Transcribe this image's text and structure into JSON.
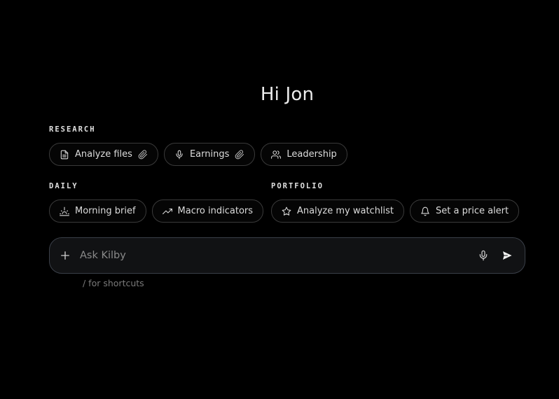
{
  "greeting": "Hi Jon",
  "sections": {
    "research": {
      "label": "RESEARCH",
      "chips": [
        {
          "label": "Analyze files",
          "icon": "file-icon",
          "trailing_icon": "paperclip-icon"
        },
        {
          "label": "Earnings",
          "icon": "microphone-icon",
          "trailing_icon": "paperclip-icon"
        },
        {
          "label": "Leadership",
          "icon": "users-icon"
        }
      ]
    },
    "daily": {
      "label": "DAILY",
      "chips": [
        {
          "label": "Morning brief",
          "icon": "sunrise-icon"
        },
        {
          "label": "Macro indicators",
          "icon": "trending-up-icon"
        }
      ]
    },
    "portfolio": {
      "label": "PORTFOLIO",
      "chips": [
        {
          "label": "Analyze my watchlist",
          "icon": "star-icon"
        },
        {
          "label": "Set a price alert",
          "icon": "bell-icon"
        }
      ]
    }
  },
  "composer": {
    "placeholder": "Ask Kilby",
    "value": "",
    "add_icon": "plus-icon",
    "mic_icon": "microphone-icon",
    "send_icon": "send-icon"
  },
  "hint": "/ for shortcuts",
  "colors": {
    "background": "#000000",
    "chip_border": "#3a3a3a",
    "composer_bg": "#111214",
    "composer_border": "#3a3f48",
    "text": "#dcdcdc",
    "muted": "#7a7a7a"
  }
}
